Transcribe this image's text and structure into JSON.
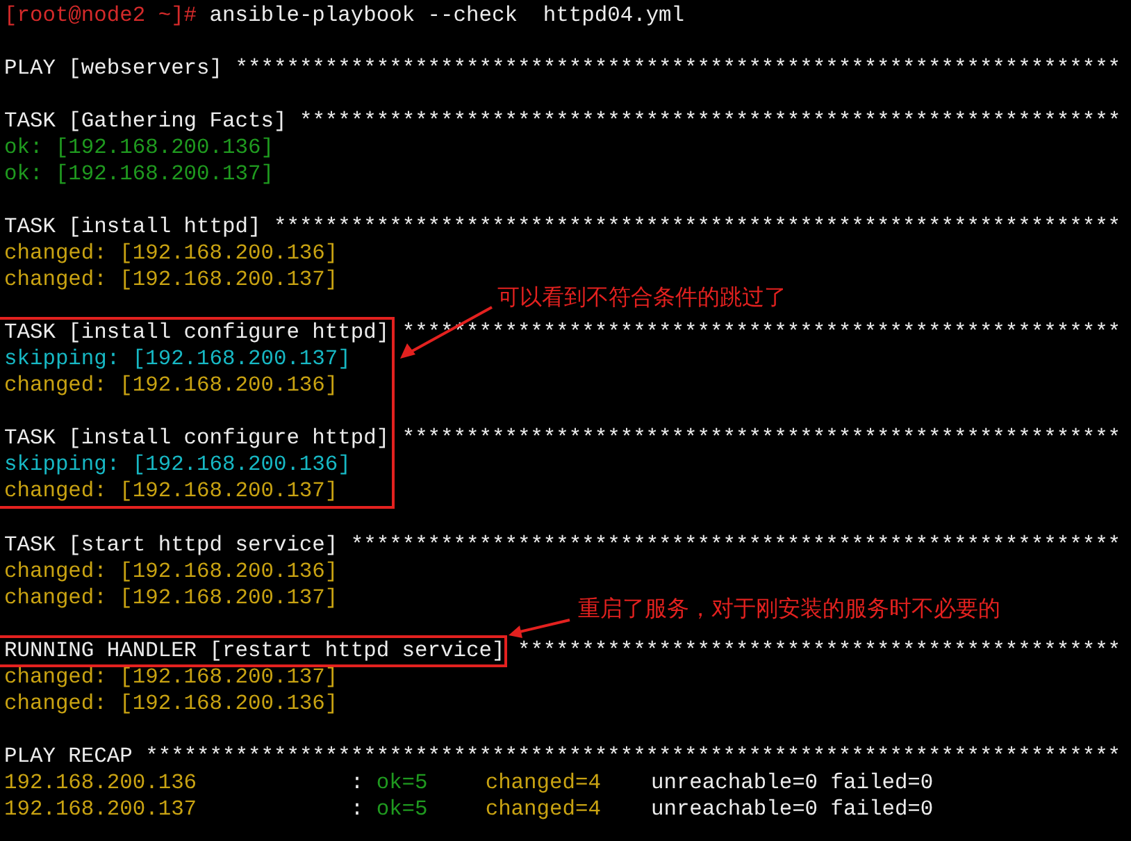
{
  "command": {
    "prompt": "[root@node2 ~]#",
    "text": "ansible-playbook --check  httpd04.yml"
  },
  "blocks": [
    {
      "header": "PLAY [webservers]",
      "stars": "*********************************************************************"
    },
    {
      "header": "TASK [Gathering Facts]",
      "stars": "****************************************************************",
      "results": [
        {
          "kind": "ok",
          "text": "ok: [192.168.200.136]"
        },
        {
          "kind": "ok",
          "text": "ok: [192.168.200.137]"
        }
      ]
    },
    {
      "header": "TASK [install httpd]",
      "stars": "******************************************************************",
      "results": [
        {
          "kind": "changed",
          "text": "changed: [192.168.200.136]"
        },
        {
          "kind": "changed",
          "text": "changed: [192.168.200.137]"
        }
      ]
    },
    {
      "header": "TASK [install configure httpd]",
      "highlighted": true,
      "stars": "********************************************************",
      "results": [
        {
          "kind": "skipping",
          "text": "skipping: [192.168.200.137]"
        },
        {
          "kind": "changed",
          "text": "changed: [192.168.200.136]"
        }
      ]
    },
    {
      "header": "TASK [install configure httpd]",
      "highlighted": true,
      "stars": "********************************************************",
      "results": [
        {
          "kind": "skipping",
          "text": "skipping: [192.168.200.136]"
        },
        {
          "kind": "changed",
          "text": "changed: [192.168.200.137]"
        }
      ]
    },
    {
      "header": "TASK [start httpd service]",
      "stars": "************************************************************",
      "results": [
        {
          "kind": "changed",
          "text": "changed: [192.168.200.136]"
        },
        {
          "kind": "changed",
          "text": "changed: [192.168.200.137]"
        }
      ]
    },
    {
      "header": "RUNNING HANDLER [restart httpd service]",
      "header_highlighted": true,
      "stars": "***********************************************",
      "results": [
        {
          "kind": "changed",
          "text": "changed: [192.168.200.137]"
        },
        {
          "kind": "changed",
          "text": "changed: [192.168.200.136]"
        }
      ]
    }
  ],
  "recap": {
    "header": "PLAY RECAP",
    "stars": "****************************************************************************",
    "rows": [
      {
        "host": "192.168.200.136",
        "separator": ":",
        "ok": "ok=5",
        "changed": "changed=4",
        "unreachable": "unreachable=0",
        "failed": "failed=0"
      },
      {
        "host": "192.168.200.137",
        "separator": ":",
        "ok": "ok=5",
        "changed": "changed=4",
        "unreachable": "unreachable=0",
        "failed": "failed=0"
      }
    ]
  },
  "annotations": [
    {
      "text": "可以看到不符合条件的跳过了"
    },
    {
      "text": "重启了服务，对于刚安装的服务时不必要的"
    }
  ]
}
